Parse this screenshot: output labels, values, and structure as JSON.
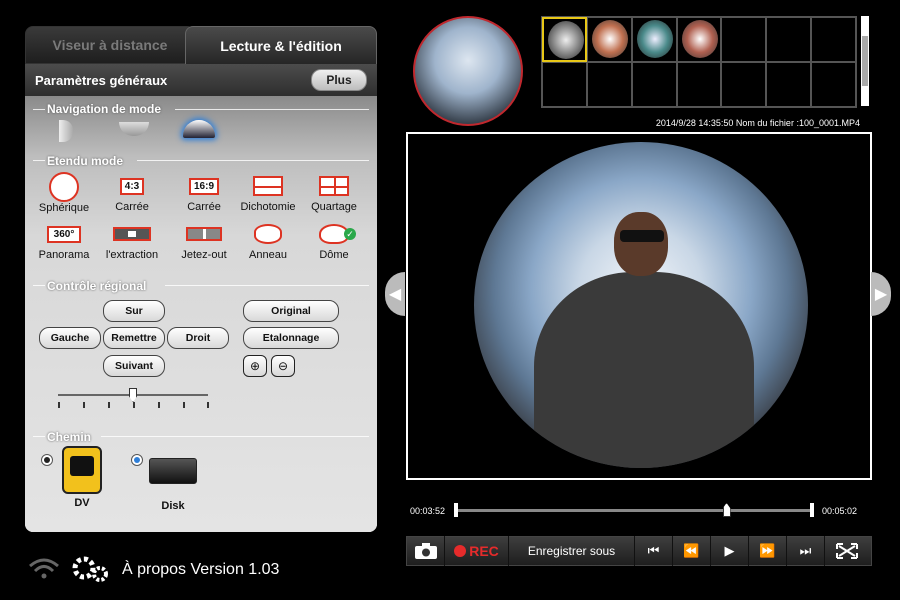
{
  "tabs": [
    {
      "label": "Viseur à distance",
      "active": false
    },
    {
      "label": "Lecture & l'édition",
      "active": true
    }
  ],
  "panel": {
    "title": "Paramètres généraux",
    "plus_label": "Plus"
  },
  "sections": {
    "navigation": "Navigation de mode",
    "extended": "Etendu mode",
    "regional": "Contrôle régional",
    "path": "Chemin"
  },
  "modes": [
    {
      "label": "Sphérique",
      "icon": "circle-icon"
    },
    {
      "label": "Carrée",
      "icon": "ratio-4-3-icon",
      "text": "4:3"
    },
    {
      "label": "Carrée",
      "icon": "ratio-16-9-icon",
      "text": "16:9"
    },
    {
      "label": "Dichotomie",
      "icon": "split-two-icon"
    },
    {
      "label": "Quartage",
      "icon": "split-four-icon"
    },
    {
      "label": "Panorama",
      "icon": "panorama-360-icon",
      "text": "360°"
    },
    {
      "label": "l'extraction",
      "icon": "extraction-icon"
    },
    {
      "label": "Jetez-out",
      "icon": "throw-out-icon"
    },
    {
      "label": "Anneau",
      "icon": "ring-icon"
    },
    {
      "label": "Dôme",
      "icon": "dome-icon"
    }
  ],
  "regional": {
    "up": "Sur",
    "left": "Gauche",
    "reset": "Remettre",
    "right": "Droit",
    "down": "Suivant",
    "original": "Original",
    "calibration": "Etalonnage"
  },
  "slider": {
    "position": 0.5
  },
  "paths": [
    {
      "label": "DV",
      "selected": false
    },
    {
      "label": "Disk",
      "selected": true
    }
  ],
  "about": "À propos Version 1.03",
  "meta": "2014/9/28 14:35:50 Nom du fichier :100_0001.MP4",
  "player": {
    "time_start": "00:03:52",
    "time_end": "00:05:02",
    "progress": 0.76,
    "rec_label": "REC",
    "save_as_label": "Enregistrer sous"
  },
  "colors": {
    "accent_red": "#d32f2f",
    "selected_thumb": "#e8c817",
    "radio_selected": "#2f7fd8"
  }
}
